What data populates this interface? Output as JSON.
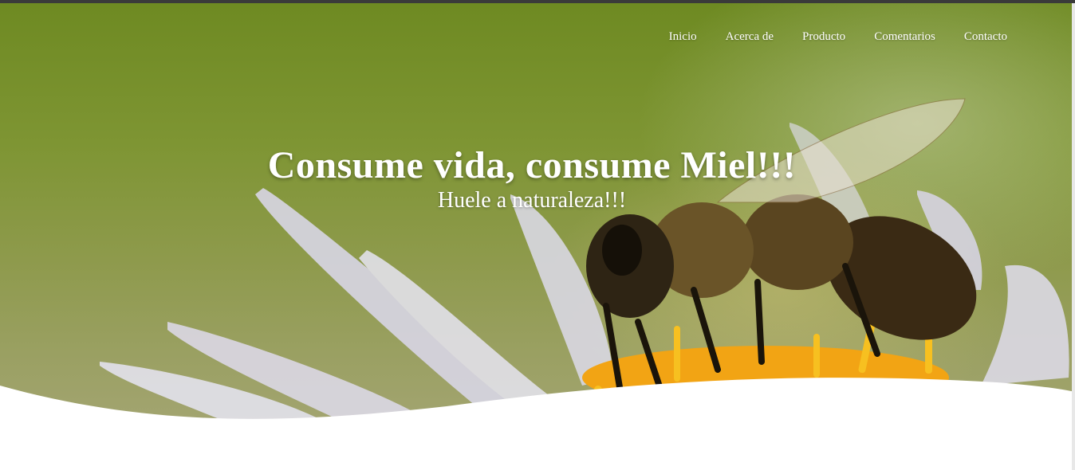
{
  "nav": {
    "items": [
      {
        "label": "Inicio"
      },
      {
        "label": "Acerca de"
      },
      {
        "label": "Producto"
      },
      {
        "label": "Comentarios"
      },
      {
        "label": "Contacto"
      }
    ]
  },
  "hero": {
    "title": "Consume vida, consume Miel!!!",
    "subtitle": "Huele a naturaleza!!!",
    "image": "bee-on-flower-photo"
  },
  "colors": {
    "overlay_green": "#7e9533",
    "text": "#ffffff",
    "topbar": "#3a3a3a"
  }
}
